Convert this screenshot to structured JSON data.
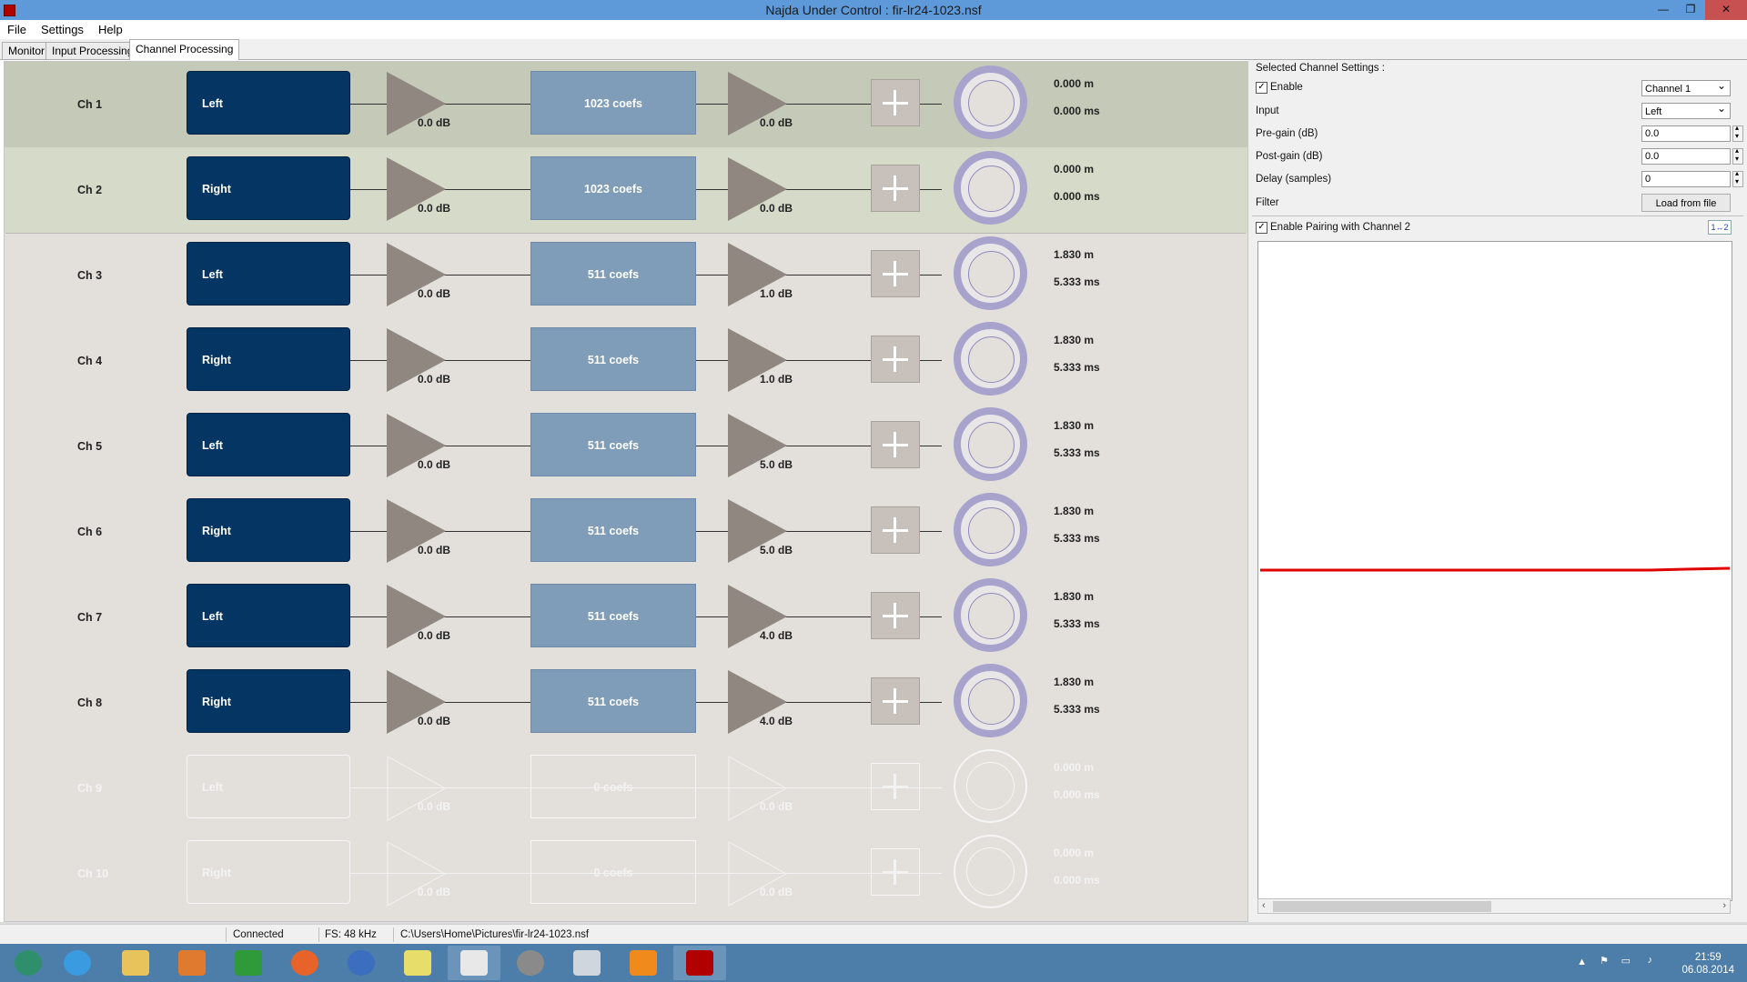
{
  "window": {
    "title": "Najda Under Control : fir-lr24-1023.nsf"
  },
  "menu": [
    "File",
    "Settings",
    "Help"
  ],
  "tabs": [
    "Monitor",
    "Input Processing",
    "Channel Processing"
  ],
  "channels": [
    {
      "label": "Ch 1",
      "input": "Left",
      "pre": "0.0 dB",
      "filter": "1023 coefs",
      "post": "0.0 dB",
      "dist": "0.000 m",
      "time": "0.000 ms"
    },
    {
      "label": "Ch 2",
      "input": "Right",
      "pre": "0.0 dB",
      "filter": "1023 coefs",
      "post": "0.0 dB",
      "dist": "0.000 m",
      "time": "0.000 ms"
    },
    {
      "label": "Ch 3",
      "input": "Left",
      "pre": "0.0 dB",
      "filter": "511 coefs",
      "post": "1.0 dB",
      "dist": "1.830 m",
      "time": "5.333 ms"
    },
    {
      "label": "Ch 4",
      "input": "Right",
      "pre": "0.0 dB",
      "filter": "511 coefs",
      "post": "1.0 dB",
      "dist": "1.830 m",
      "time": "5.333 ms"
    },
    {
      "label": "Ch 5",
      "input": "Left",
      "pre": "0.0 dB",
      "filter": "511 coefs",
      "post": "5.0 dB",
      "dist": "1.830 m",
      "time": "5.333 ms"
    },
    {
      "label": "Ch 6",
      "input": "Right",
      "pre": "0.0 dB",
      "filter": "511 coefs",
      "post": "5.0 dB",
      "dist": "1.830 m",
      "time": "5.333 ms"
    },
    {
      "label": "Ch 7",
      "input": "Left",
      "pre": "0.0 dB",
      "filter": "511 coefs",
      "post": "4.0 dB",
      "dist": "1.830 m",
      "time": "5.333 ms"
    },
    {
      "label": "Ch 8",
      "input": "Right",
      "pre": "0.0 dB",
      "filter": "511 coefs",
      "post": "4.0 dB",
      "dist": "1.830 m",
      "time": "5.333 ms"
    },
    {
      "label": "Ch 9",
      "input": "Left",
      "pre": "0.0 dB",
      "filter": "0 coefs",
      "post": "0.0 dB",
      "dist": "0.000 m",
      "time": "0.000 ms"
    },
    {
      "label": "Ch 10",
      "input": "Right",
      "pre": "0.0 dB",
      "filter": "0 coefs",
      "post": "0.0 dB",
      "dist": "0.000 m",
      "time": "0.000 ms"
    }
  ],
  "settings": {
    "heading": "Selected Channel Settings :",
    "enable_label": "Enable",
    "channel_select": "Channel 1",
    "input_label": "Input",
    "input_select": "Left",
    "pregain_label": "Pre-gain (dB)",
    "pregain_value": "0.0",
    "postgain_label": "Post-gain (dB)",
    "postgain_value": "0.0",
    "delay_label": "Delay (samples)",
    "delay_value": "0",
    "filter_label": "Filter",
    "load_button": "Load from file",
    "pairing_label": "Enable Pairing with Channel 2",
    "pairing_button": "1↔2"
  },
  "status": {
    "connection": "Connected",
    "fs": "FS: 48 kHz",
    "path": "C:\\Users\\Home\\Pictures\\fir-lr24-1023.nsf"
  },
  "clock": {
    "time": "21:59",
    "date": "06.08.2014"
  },
  "colors": {
    "selected_row": "#c4c9b8",
    "input_box": "#053562",
    "filter_box": "#7f9cb8",
    "gain_triangle": "#8f8780",
    "delay_ring": "#a8a3cc",
    "response_line": "#e00000"
  }
}
